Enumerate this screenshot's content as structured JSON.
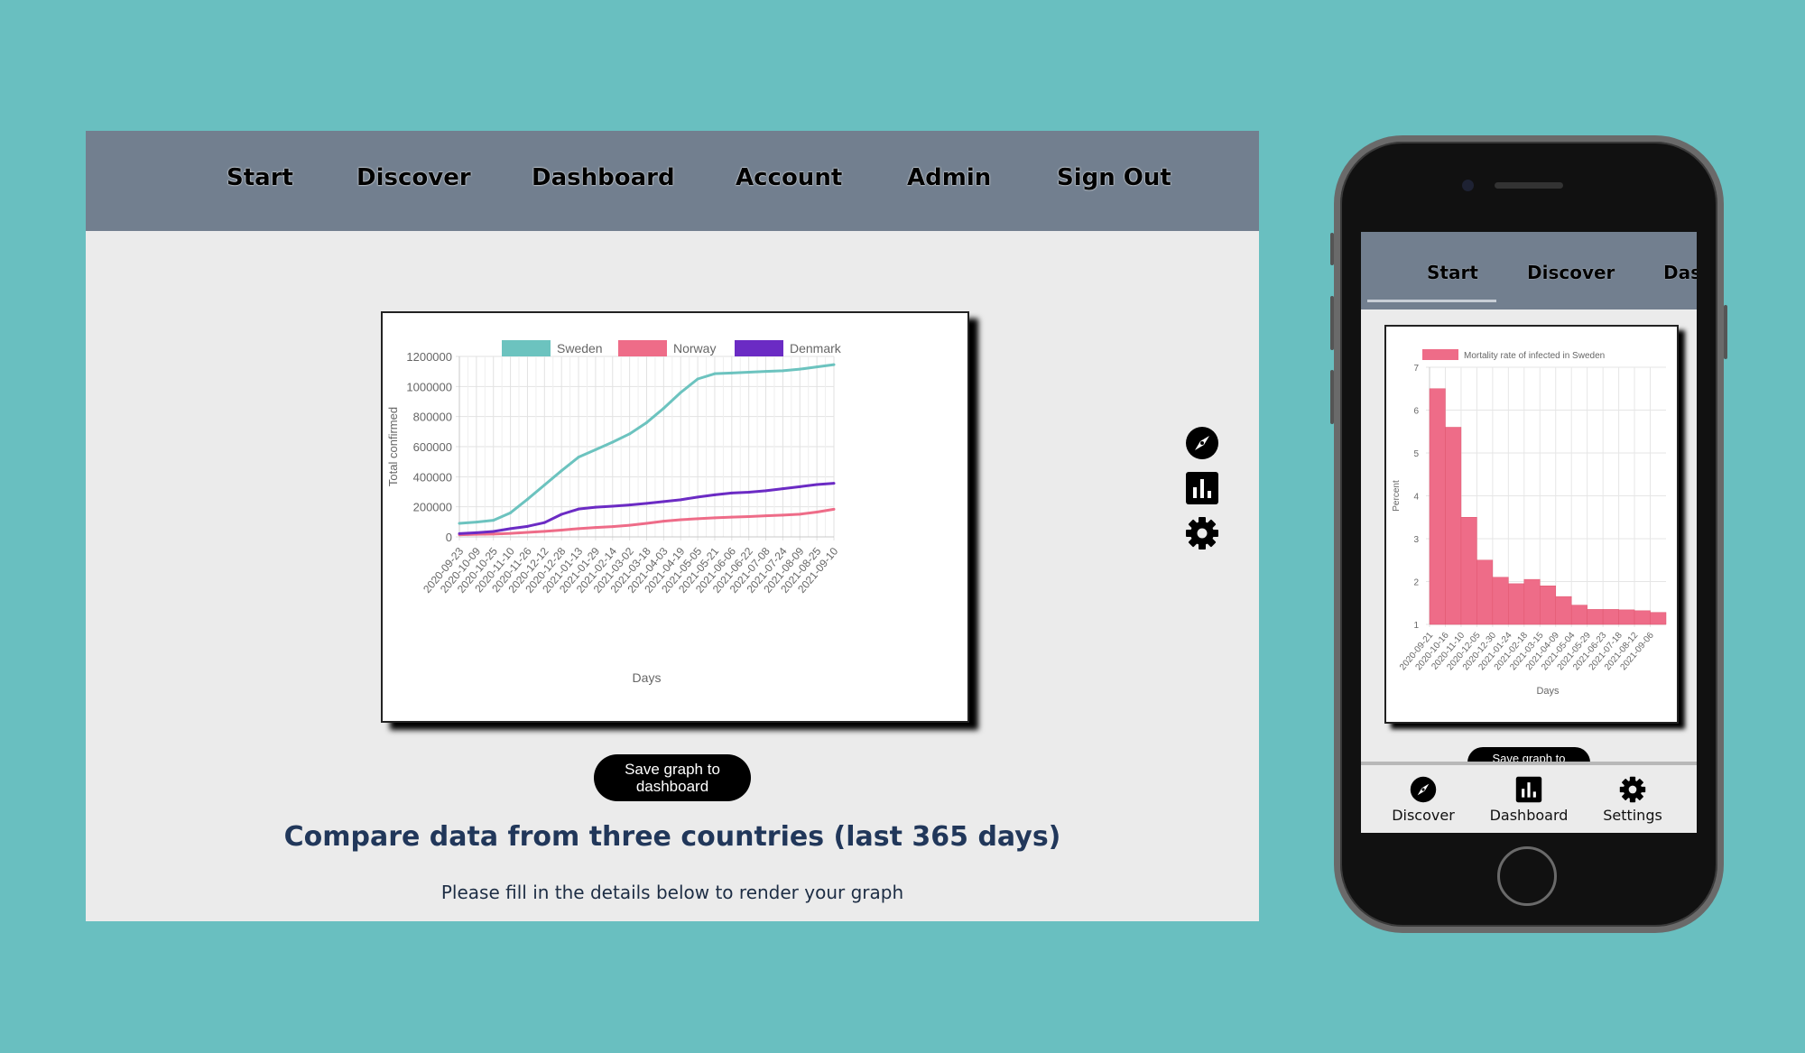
{
  "desktop": {
    "nav": [
      "Start",
      "Discover",
      "Dashboard",
      "Account",
      "Admin",
      "Sign Out"
    ],
    "save_button": "Save graph to\ndashboard",
    "heading": "Compare data from three countries (last 365 days)",
    "subheading": "Please fill in the details below to render your graph",
    "side_icons": [
      "compass-icon",
      "bar-chart-icon",
      "gear-icon"
    ]
  },
  "phone": {
    "nav": [
      "Start",
      "Discover",
      "Das"
    ],
    "save_button": "Save graph to",
    "bottom_nav": [
      {
        "label": "Discover",
        "icon": "compass-icon"
      },
      {
        "label": "Dashboard",
        "icon": "bar-chart-icon"
      },
      {
        "label": "Settings",
        "icon": "gear-icon"
      }
    ]
  },
  "chart_data": [
    {
      "type": "line",
      "ylabel": "Total confirmed",
      "xlabel": "Days",
      "ylim": [
        0,
        1200000
      ],
      "yticks": [
        0,
        200000,
        400000,
        600000,
        800000,
        1000000,
        1200000
      ],
      "x": [
        "2020-09-23",
        "2020-10-09",
        "2020-10-25",
        "2020-11-10",
        "2020-11-26",
        "2020-12-12",
        "2020-12-28",
        "2021-01-13",
        "2021-01-29",
        "2021-02-14",
        "2021-03-02",
        "2021-03-18",
        "2021-04-03",
        "2021-04-19",
        "2021-05-05",
        "2021-05-21",
        "2021-06-06",
        "2021-06-22",
        "2021-07-08",
        "2021-07-24",
        "2021-08-09",
        "2021-08-25",
        "2021-09-10"
      ],
      "legend_position": "top",
      "grid": true,
      "series": [
        {
          "name": "Sweden",
          "color": "#6cc3bf",
          "values": [
            90000,
            98000,
            110000,
            160000,
            250000,
            345000,
            440000,
            530000,
            580000,
            630000,
            685000,
            760000,
            855000,
            960000,
            1050000,
            1085000,
            1090000,
            1095000,
            1100000,
            1105000,
            1115000,
            1130000,
            1145000
          ]
        },
        {
          "name": "Norway",
          "color": "#ee6c88",
          "values": [
            14000,
            17000,
            19000,
            23000,
            30000,
            37000,
            45000,
            55000,
            62000,
            68000,
            77000,
            90000,
            104000,
            114000,
            121000,
            127000,
            131000,
            135000,
            140000,
            145000,
            151000,
            165000,
            184000
          ]
        },
        {
          "name": "Denmark",
          "color": "#6b2bc4",
          "values": [
            22000,
            28000,
            36000,
            55000,
            70000,
            95000,
            150000,
            185000,
            197000,
            204000,
            212000,
            223000,
            235000,
            247000,
            265000,
            280000,
            292000,
            297000,
            307000,
            320000,
            334000,
            348000,
            356000
          ]
        }
      ]
    },
    {
      "type": "bar",
      "ylabel": "Percent",
      "xlabel": "Days",
      "ylim": [
        1,
        7
      ],
      "yticks": [
        1,
        2,
        3,
        4,
        5,
        6,
        7
      ],
      "x": [
        "2020-09-21",
        "2020-10-16",
        "2020-11-10",
        "2020-12-05",
        "2020-12-30",
        "2021-01-24",
        "2021-02-18",
        "2021-03-15",
        "2021-04-09",
        "2021-05-04",
        "2021-05-29",
        "2021-06-23",
        "2021-07-18",
        "2021-08-12",
        "2021-09-06"
      ],
      "legend_position": "top",
      "grid": true,
      "series": [
        {
          "name": "Mortality rate of infected in Sweden",
          "color": "#ee6c88",
          "values": [
            6.5,
            5.6,
            3.5,
            2.5,
            2.1,
            1.95,
            2.05,
            1.9,
            1.65,
            1.45,
            1.35,
            1.35,
            1.34,
            1.32,
            1.28
          ]
        }
      ]
    }
  ]
}
